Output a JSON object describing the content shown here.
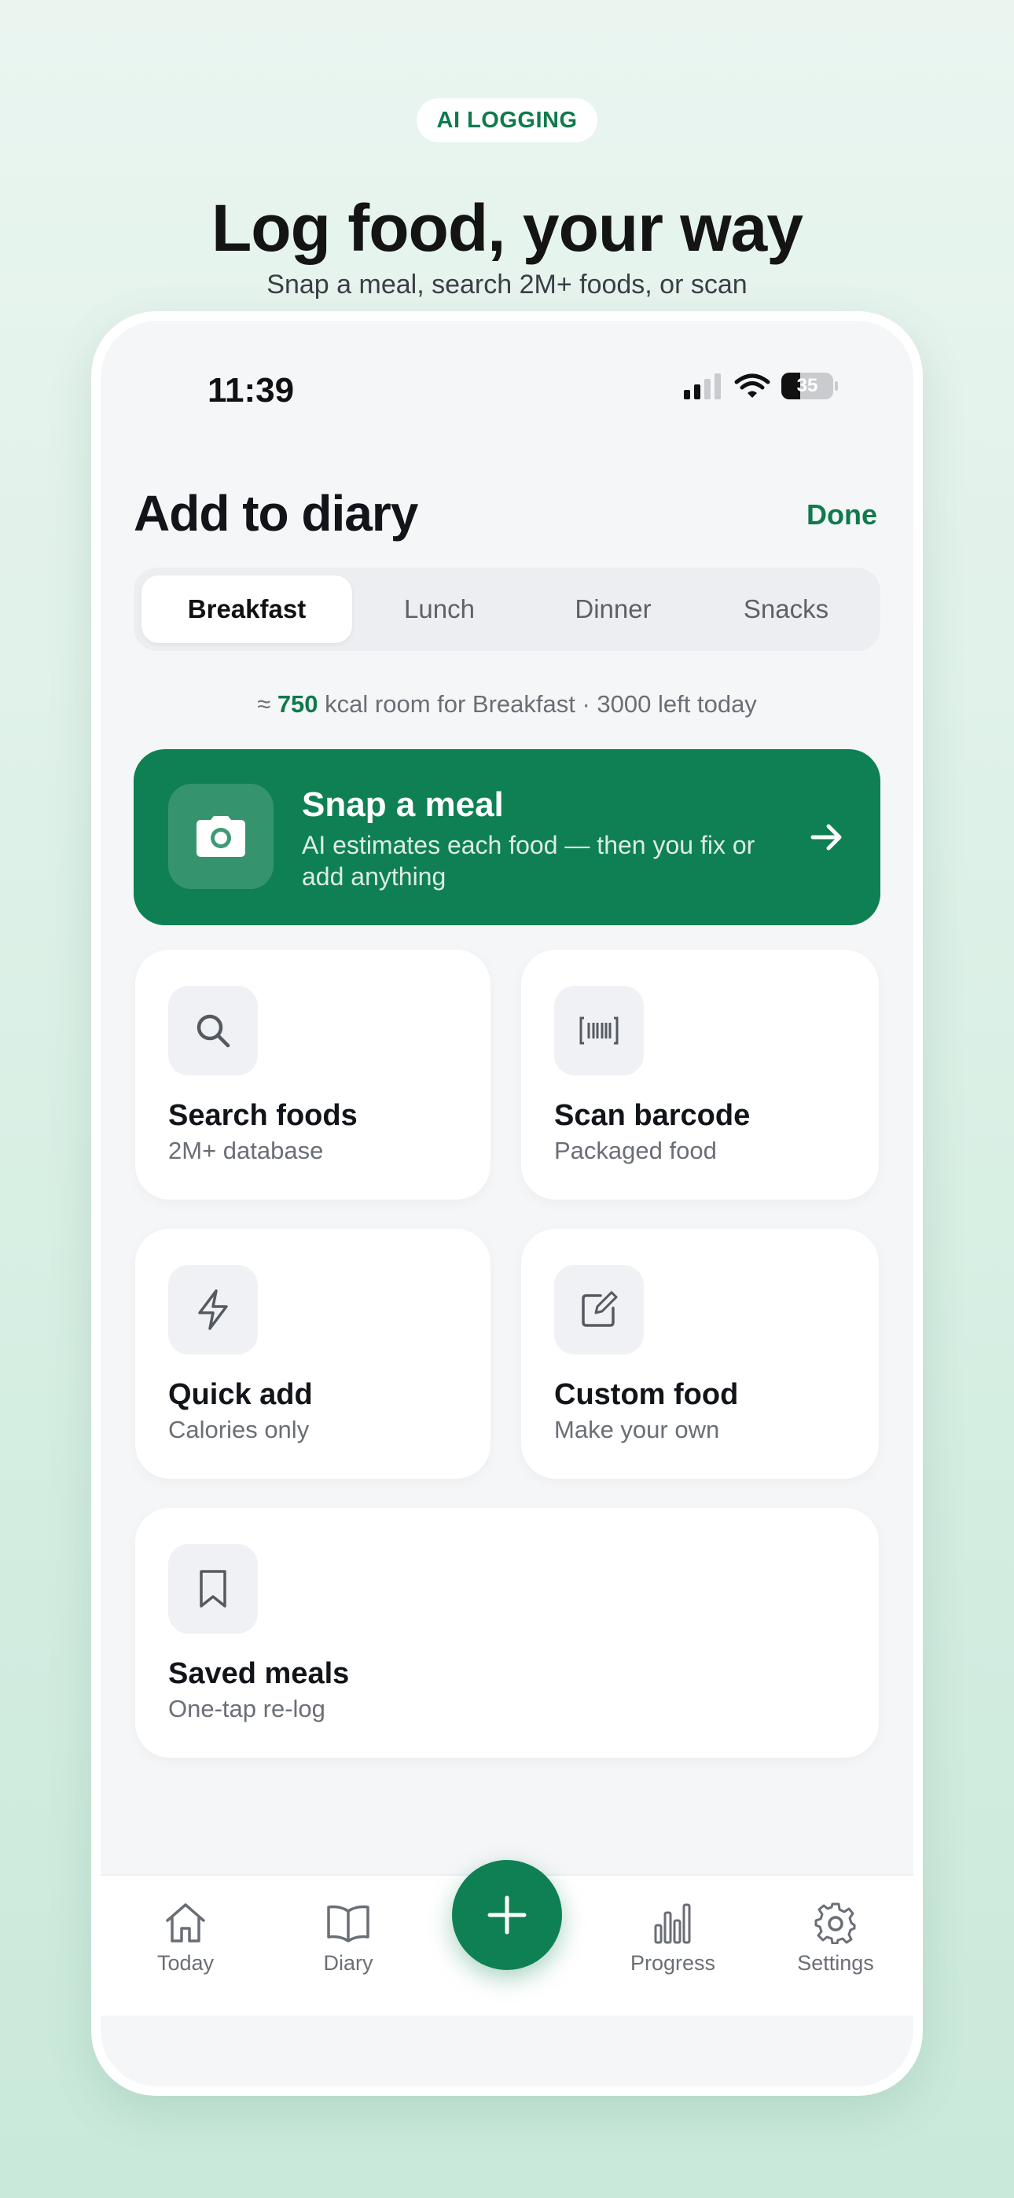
{
  "promo": {
    "badge": "AI LOGGING",
    "headline": "Log food, your way",
    "subheadline": "Snap a meal, search 2M+ foods, or scan"
  },
  "status_bar": {
    "time": "11:39",
    "battery": "35"
  },
  "header": {
    "title": "Add to diary",
    "done_label": "Done"
  },
  "meal_tabs": {
    "selected": "Breakfast",
    "items": [
      "Breakfast",
      "Lunch",
      "Dinner",
      "Snacks"
    ]
  },
  "room": {
    "prefix": "≈ ",
    "kcal": "750",
    "suffix": " kcal room for Breakfast · 3000 left today"
  },
  "snap_card": {
    "title": "Snap a meal",
    "subtitle": "AI estimates each food — then you fix or add anything",
    "icon": "camera-icon"
  },
  "options": [
    {
      "title": "Search foods",
      "subtitle": "2M+ database",
      "icon": "search-icon"
    },
    {
      "title": "Scan barcode",
      "subtitle": "Packaged food",
      "icon": "barcode-icon"
    },
    {
      "title": "Quick add",
      "subtitle": "Calories only",
      "icon": "lightning-icon"
    },
    {
      "title": "Custom food",
      "subtitle": "Make your own",
      "icon": "edit-icon"
    },
    {
      "title": "Saved meals",
      "subtitle": "One-tap re-log",
      "icon": "bookmark-icon"
    }
  ],
  "tab_bar": {
    "items": [
      {
        "label": "Today",
        "icon": "home-icon"
      },
      {
        "label": "Diary",
        "icon": "book-icon"
      },
      {
        "label": "Progress",
        "icon": "bar-chart-icon"
      },
      {
        "label": "Settings",
        "icon": "gear-icon"
      }
    ],
    "fab_icon": "plus-icon"
  },
  "colors": {
    "accent": "#0f8053",
    "accent_text": "#0f7a4c",
    "screen_bg": "#f5f6f8",
    "muted_text": "#6a6e75"
  }
}
